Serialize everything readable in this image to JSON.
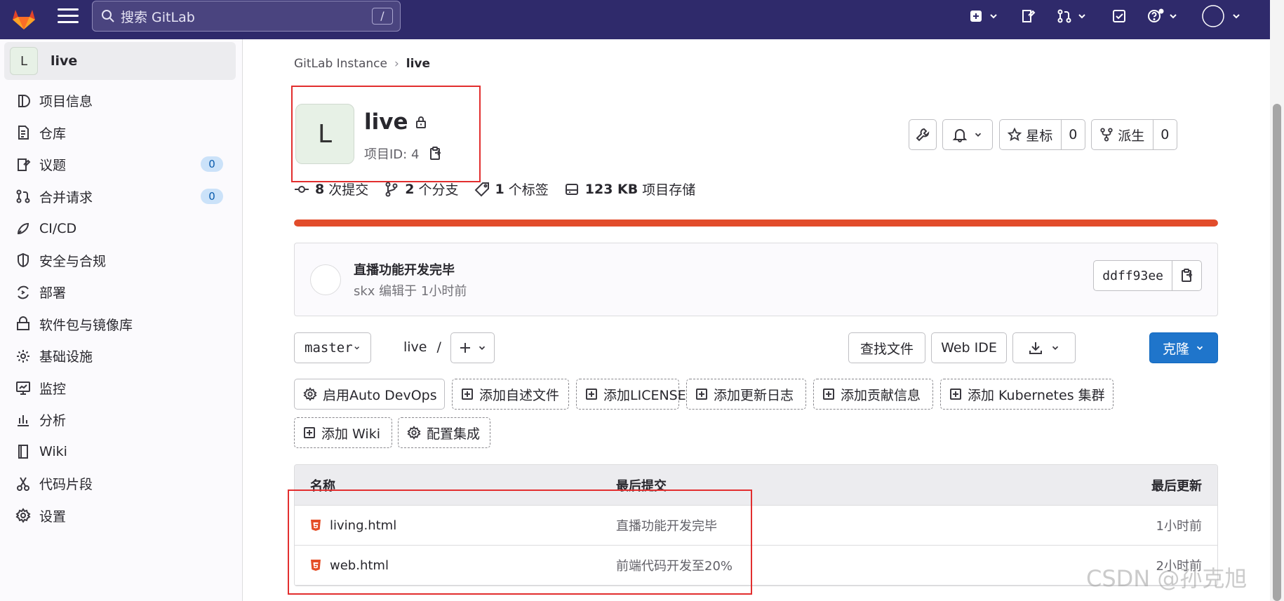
{
  "topbar": {
    "search_placeholder": "搜索 GitLab",
    "search_shortcut": "/"
  },
  "sidebar": {
    "project_initial": "L",
    "project_name": "live",
    "items": [
      {
        "label": "项目信息",
        "icon": "info-icon"
      },
      {
        "label": "仓库",
        "icon": "repository-icon"
      },
      {
        "label": "议题",
        "icon": "issues-icon",
        "badge": "0"
      },
      {
        "label": "合并请求",
        "icon": "merge-request-icon",
        "badge": "0"
      },
      {
        "label": "CI/CD",
        "icon": "rocket-icon"
      },
      {
        "label": "安全与合规",
        "icon": "shield-icon"
      },
      {
        "label": "部署",
        "icon": "deployments-icon"
      },
      {
        "label": "软件包与镜像库",
        "icon": "package-icon"
      },
      {
        "label": "基础设施",
        "icon": "infrastructure-icon"
      },
      {
        "label": "监控",
        "icon": "monitor-icon"
      },
      {
        "label": "分析",
        "icon": "chart-icon"
      },
      {
        "label": "Wiki",
        "icon": "book-icon"
      },
      {
        "label": "代码片段",
        "icon": "snippet-icon"
      },
      {
        "label": "设置",
        "icon": "settings-icon"
      }
    ]
  },
  "breadcrumb": {
    "root": "GitLab Instance",
    "separator": "›",
    "current": "live"
  },
  "project": {
    "initial": "L",
    "name": "live",
    "id_label": "项目ID: 4",
    "star_label": "星标",
    "star_count": "0",
    "fork_label": "派生",
    "fork_count": "0"
  },
  "stats": {
    "commits_num": "8",
    "commits_label": "次提交",
    "branches_num": "2",
    "branches_label": "个分支",
    "tags_num": "1",
    "tags_label": "个标签",
    "storage_num": "123 KB",
    "storage_label": "项目存储"
  },
  "language_bar": {
    "fraction": 1.0,
    "color": "#e24c2b"
  },
  "last_commit": {
    "title": "直播功能开发完毕",
    "meta": "skx 编辑于 1小时前",
    "sha": "ddff93ee"
  },
  "repo_toolbar": {
    "branch": "master",
    "path_root": "live",
    "path_sep": "/",
    "find_file": "查找文件",
    "web_ide": "Web IDE",
    "clone": "克隆"
  },
  "quick_actions": [
    "启用Auto DevOps",
    "添加自述文件",
    "添加LICENSE",
    "添加更新日志",
    "添加贡献信息",
    "添加 Kubernetes 集群",
    "添加 Wiki",
    "配置集成"
  ],
  "file_table": {
    "headers": [
      "名称",
      "最后提交",
      "最后更新"
    ],
    "rows": [
      {
        "name": "living.html",
        "commit": "直播功能开发完毕",
        "updated": "1小时前"
      },
      {
        "name": "web.html",
        "commit": "前端代码开发至20%",
        "updated": "2小时前"
      }
    ]
  },
  "watermark": "CSDN @孙克旭",
  "colors": {
    "topbar": "#2f2a6b",
    "primary": "#1f75cb",
    "language_bar": "#e24c2b",
    "highlight_box": "#e22e2e"
  }
}
